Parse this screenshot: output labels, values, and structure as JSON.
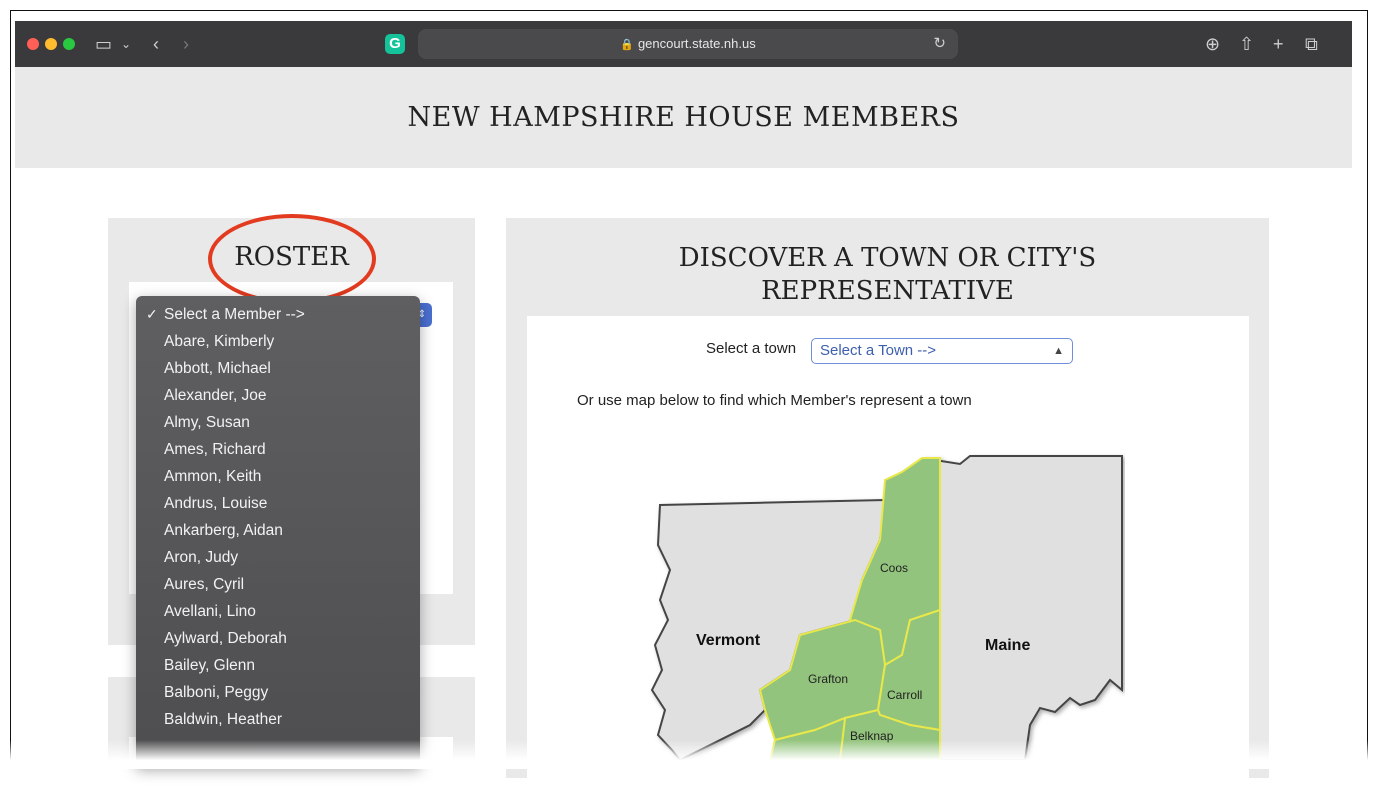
{
  "browser": {
    "url": "gencourt.state.nh.us",
    "icons": [
      "close-dot",
      "minimize-dot",
      "maximize-dot",
      "sidebar-icon",
      "chevron-down-icon",
      "back-icon",
      "forward-icon",
      "grammarly-icon",
      "lock-icon",
      "reload-icon",
      "download-icon",
      "share-icon",
      "new-tab-icon",
      "tabs-icon"
    ],
    "grammarly_letter": "G"
  },
  "page": {
    "title": "NEW HAMPSHIRE HOUSE MEMBERS"
  },
  "roster": {
    "heading": "ROSTER",
    "highlight_color": "#e23b1f",
    "members": [
      "Select a Member -->",
      "Abare, Kimberly",
      "Abbott, Michael",
      "Alexander, Joe",
      "Almy, Susan",
      "Ames, Richard",
      "Ammon, Keith",
      "Andrus, Louise",
      "Ankarberg, Aidan",
      "Aron, Judy",
      "Aures, Cyril",
      "Avellani, Lino",
      "Aylward, Deborah",
      "Bailey, Glenn",
      "Balboni, Peggy",
      "Baldwin, Heather"
    ],
    "selected_index": 0
  },
  "discover": {
    "heading_line1": "DISCOVER A TOWN OR CITY'S",
    "heading_line2": "REPRESENTATIVE",
    "select_label": "Select a town",
    "select_value": "Select a Town -->",
    "map_note": "Or use map below to find which Member's represent a town",
    "map": {
      "states": [
        "Vermont",
        "Maine"
      ],
      "counties": [
        "Coos",
        "Grafton",
        "Carroll",
        "Belknap"
      ],
      "county_color": "#93c47d",
      "state_color": "#e0e0e0",
      "border_color": "#e8e84a"
    }
  }
}
